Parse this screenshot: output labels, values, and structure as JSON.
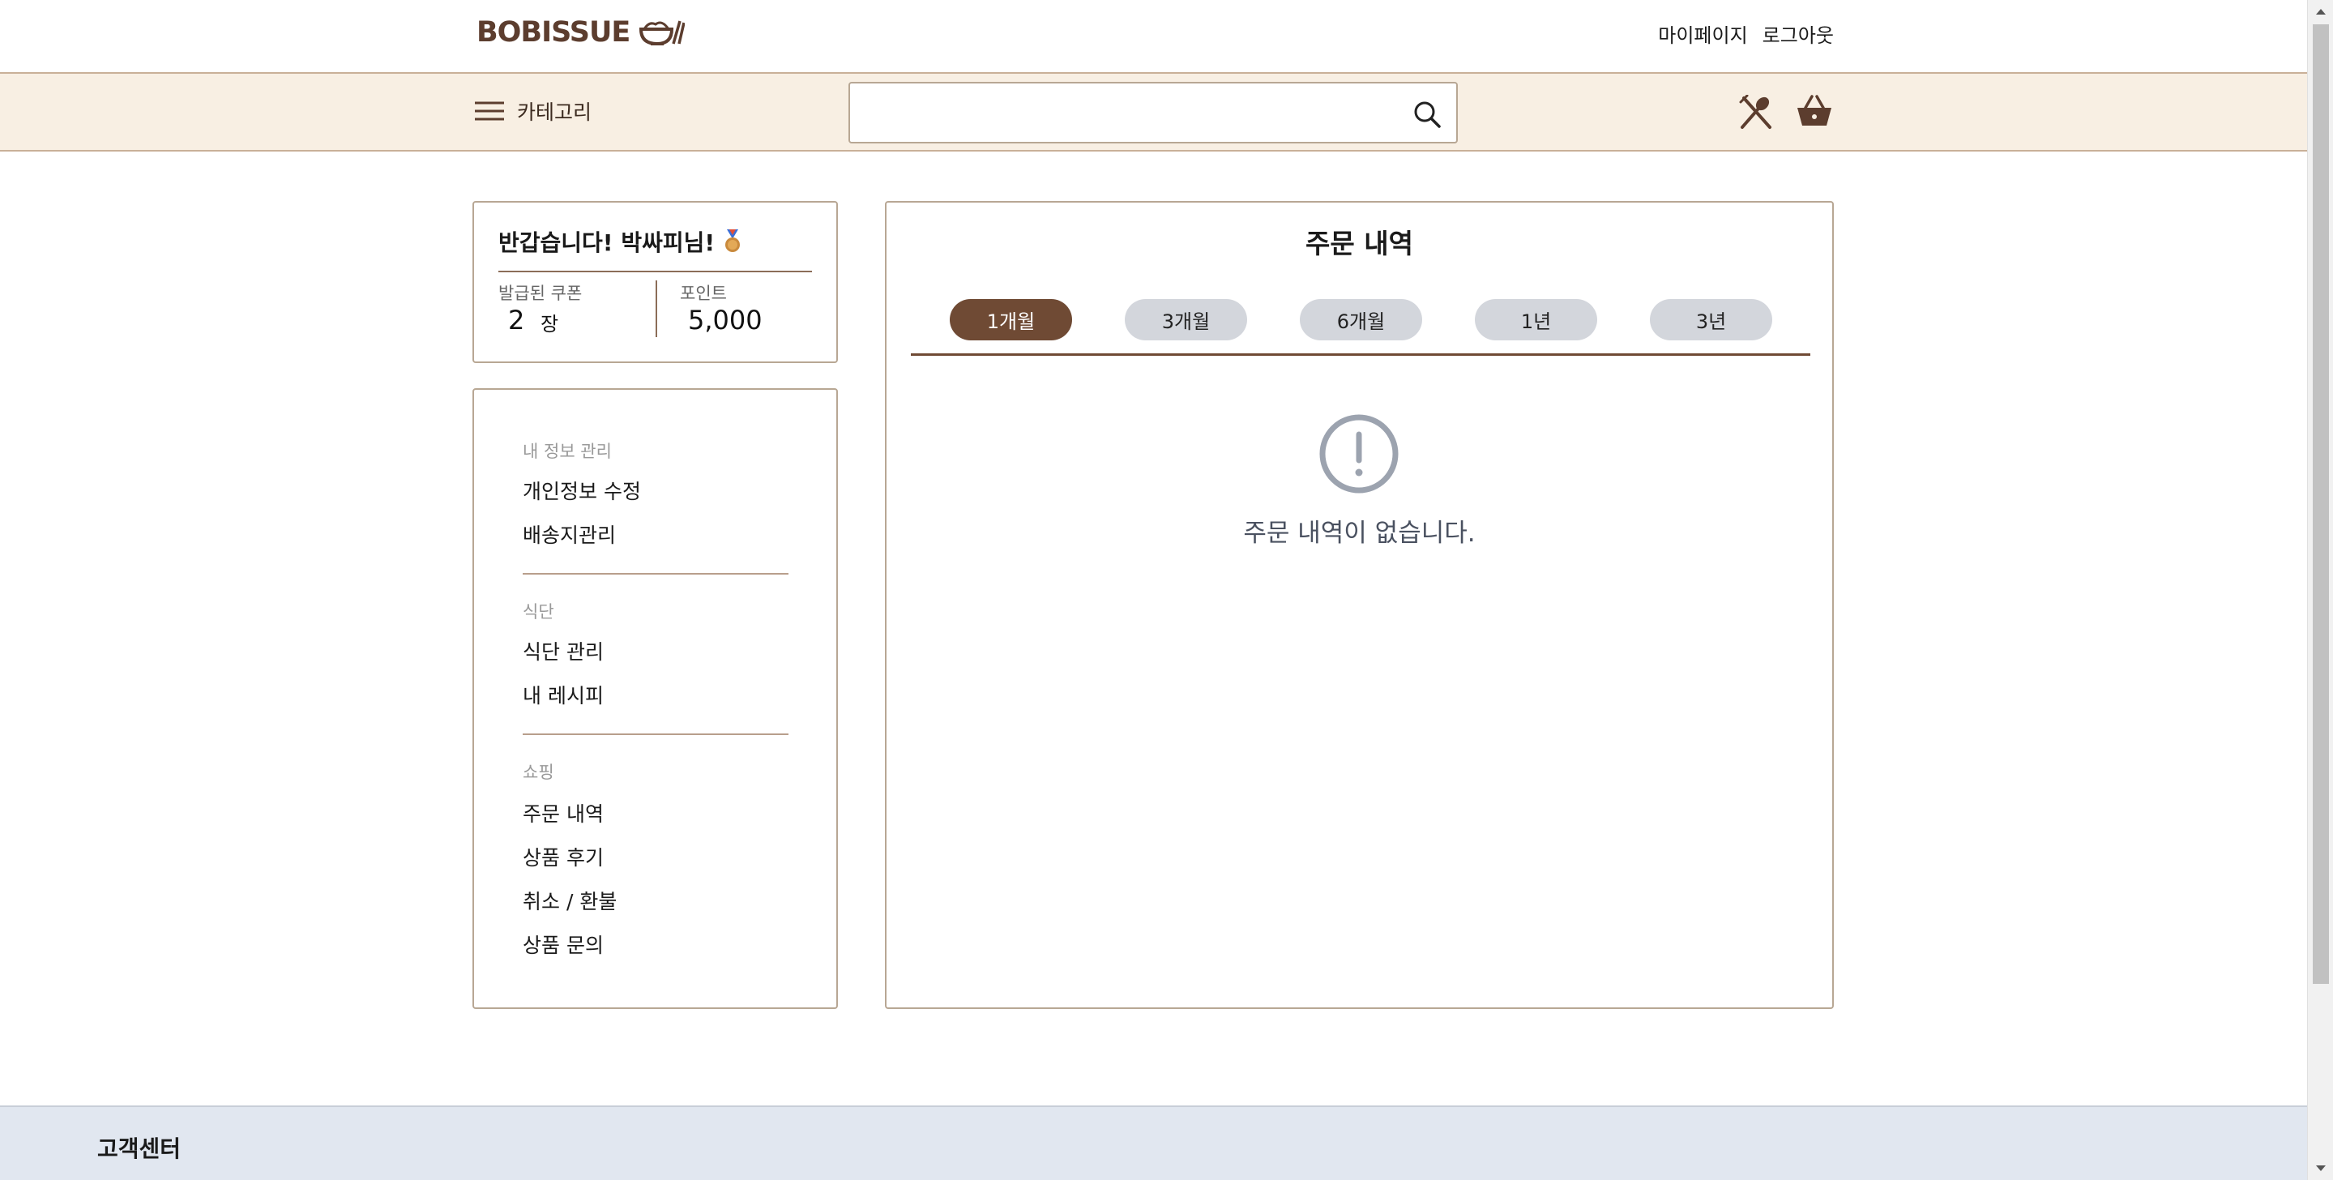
{
  "header": {
    "logo_text": "BOBISSUE",
    "links": [
      "마이페이지",
      "로그아웃"
    ]
  },
  "nav": {
    "category_label": "카테고리",
    "search_placeholder": ""
  },
  "profile": {
    "greeting": "반갑습니다! 박싸피님!",
    "coupon_label": "발급된 쿠폰",
    "coupon_count": "2",
    "coupon_unit": "장",
    "point_label": "포인트",
    "point_value": "5,000"
  },
  "sidebar": {
    "sections": [
      {
        "title": "내 정보 관리",
        "items": [
          "개인정보 수정",
          "배송지관리"
        ]
      },
      {
        "title": "식단",
        "items": [
          "식단 관리",
          "내 레시피"
        ]
      },
      {
        "title": "쇼핑",
        "items": [
          "주문 내역",
          "상품 후기",
          "취소 / 환불",
          "상품 문의"
        ]
      }
    ]
  },
  "main": {
    "title": "주문 내역",
    "tabs": [
      {
        "label": "1개월",
        "active": true
      },
      {
        "label": "3개월",
        "active": false
      },
      {
        "label": "6개월",
        "active": false
      },
      {
        "label": "1년",
        "active": false
      },
      {
        "label": "3년",
        "active": false
      }
    ],
    "empty_message": "주문 내역이 없습니다."
  },
  "footer": {
    "title": "고객센터"
  },
  "colors": {
    "brand_brown": "#6f4a34",
    "nav_bg": "#f8efe3",
    "tab_inactive": "#d3d6dc",
    "footer_bg": "#e1e7f0"
  }
}
